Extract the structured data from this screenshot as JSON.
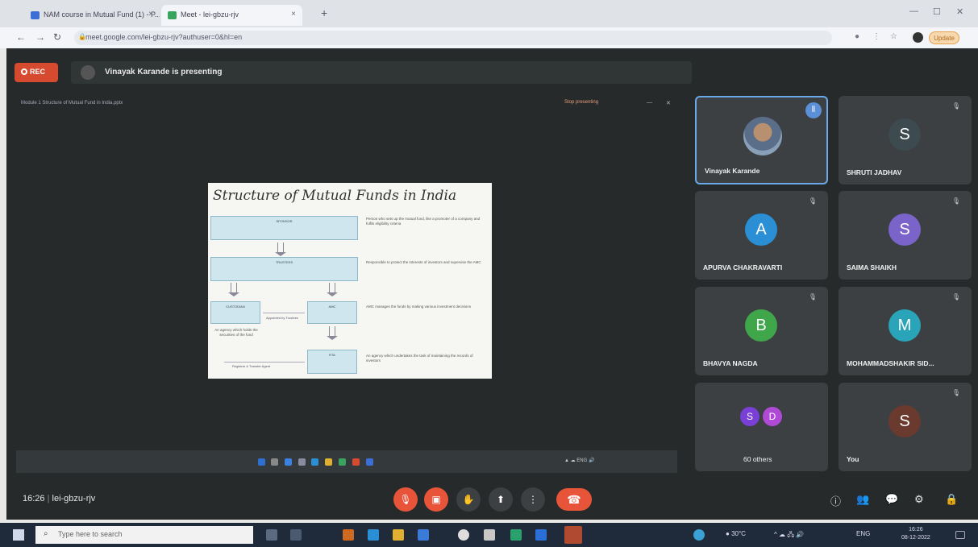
{
  "browser": {
    "tabs": [
      {
        "title": "NAM course in Mutual Fund (1) - P...",
        "favicon_color": "#3b6fd6"
      },
      {
        "title": "Meet - lei-gbzu-rjv",
        "favicon_color": "#3aa35f"
      }
    ],
    "url": "meet.google.com/lei-gbzu-rjv?authuser=0&hl=en",
    "update_label": "Update"
  },
  "meet": {
    "rec_label": "REC",
    "presenter_text": "Vinayak Karande is presenting",
    "share_title": "Module 1 Structure of Mutual Fund in India.pptx",
    "stop_label": "Stop presenting",
    "meeting_time": "16:26",
    "meeting_code": "lei-gbzu-rjv"
  },
  "slide": {
    "title": "Structure of Mutual Funds in India",
    "boxes": [
      "SPONSOR",
      "TRUSTEES",
      "CUSTODIAN",
      "AMC",
      "RTA"
    ],
    "descriptions": [
      "Person who sets up the mutual fund, like a promoter of a company and fulfils eligibility criteria",
      "Responsible to protect the interests of investors and supervise the AMC",
      "AMC manages the funds by making various investment decisions",
      "An agency which undertakes the task of maintaining the records of investors"
    ],
    "custodian_note": "An agency which holds the securities of the fund",
    "link_label": "Appointed by Trustees",
    "rta_label": "Registrar & Transfer Agent"
  },
  "participants": [
    {
      "name": "Vinayak Karande",
      "initial": "",
      "color": "",
      "active": true
    },
    {
      "name": "SHRUTI JADHAV",
      "initial": "S",
      "color": "#3d4a4f"
    },
    {
      "name": "APURVA CHAKRAVARTI",
      "initial": "A",
      "color": "#2b8fd6"
    },
    {
      "name": "SAIMA SHAIKH",
      "initial": "S",
      "color": "#7a63c9"
    },
    {
      "name": "BHAVYA NAGDA",
      "initial": "B",
      "color": "#3fa64a"
    },
    {
      "name": "MOHAMMADSHAKIR SID...",
      "initial": "M",
      "color": "#2aa4b8"
    },
    {
      "name": "60 others",
      "initial": "",
      "color": ""
    },
    {
      "name": "You",
      "initial": "S",
      "color": "#6a3a2f"
    }
  ],
  "others_avatars": [
    {
      "initial": "S",
      "color": "#7a3fd6"
    },
    {
      "initial": "D",
      "color": "#b04ad6"
    }
  ],
  "taskbar": {
    "search_placeholder": "Type here to search",
    "weather": "30°C",
    "lang": "ENG",
    "time": "16:26",
    "date": "08-12-2022"
  }
}
